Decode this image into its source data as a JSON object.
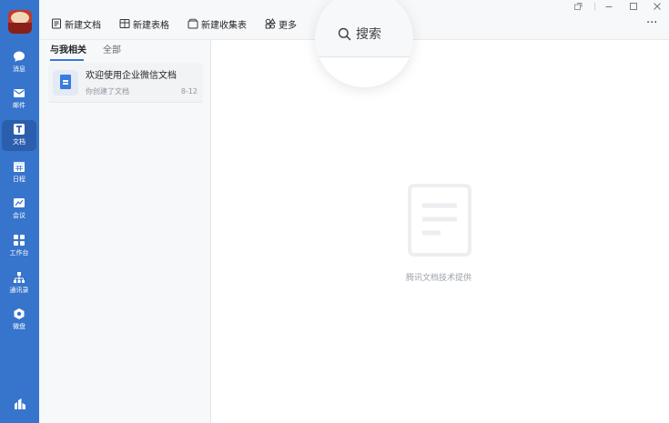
{
  "toolbar": {
    "new_doc": "新建文档",
    "new_sheet": "新建表格",
    "new_form": "新建收集表",
    "more": "更多",
    "overflow": "···"
  },
  "search": {
    "label": "搜索"
  },
  "sidebar": {
    "items": [
      {
        "label": "消息",
        "icon": "message-icon"
      },
      {
        "label": "邮件",
        "icon": "mail-icon"
      },
      {
        "label": "文档",
        "icon": "document-icon",
        "active": true
      },
      {
        "label": "日程",
        "icon": "calendar-icon"
      },
      {
        "label": "会议",
        "icon": "meeting-icon"
      },
      {
        "label": "工作台",
        "icon": "workbench-icon"
      },
      {
        "label": "通讯录",
        "icon": "contacts-icon"
      },
      {
        "label": "微盘",
        "icon": "drive-icon"
      }
    ]
  },
  "list": {
    "tabs": [
      {
        "label": "与我相关",
        "active": true
      },
      {
        "label": "全部"
      }
    ],
    "items": [
      {
        "title": "欢迎使用企业微信文档",
        "subtitle": "你创建了文档",
        "date": "8-12"
      }
    ]
  },
  "empty_state": {
    "text": "腾讯文档技术提供"
  },
  "colors": {
    "rail": "#3774cc",
    "accent": "#3a76d8"
  }
}
